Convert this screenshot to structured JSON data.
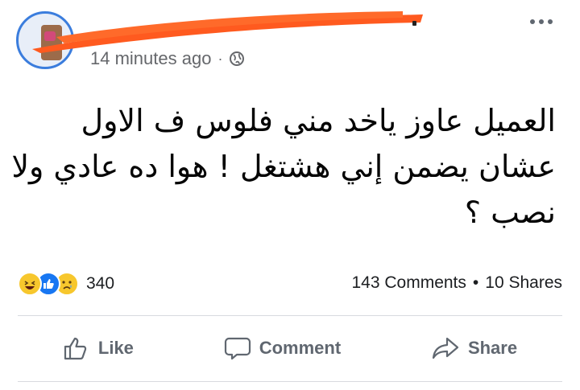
{
  "post": {
    "timestamp": "14 minutes ago",
    "separator": "·",
    "privacy_icon": "globe-icon",
    "text_lines": [
      "العميل عاوز ياخد مني فلوس ف الاول",
      "عشان يضمن إني هشتغل ! هوا ده عادي ولا",
      "نصب ؟"
    ]
  },
  "engagement": {
    "reactions": [
      "haha-reaction-icon",
      "like-reaction-icon",
      "sad-reaction-icon"
    ],
    "reaction_count": "340",
    "comments": "143 Comments",
    "separator": "•",
    "shares": "10 Shares"
  },
  "actions": {
    "like_label": "Like",
    "comment_label": "Comment",
    "share_label": "Share"
  },
  "colors": {
    "redaction": "#ff5a1f",
    "avatar_ring": "#3b7ddd",
    "like_blue": "#1877f2",
    "meta_gray": "#65676b"
  }
}
